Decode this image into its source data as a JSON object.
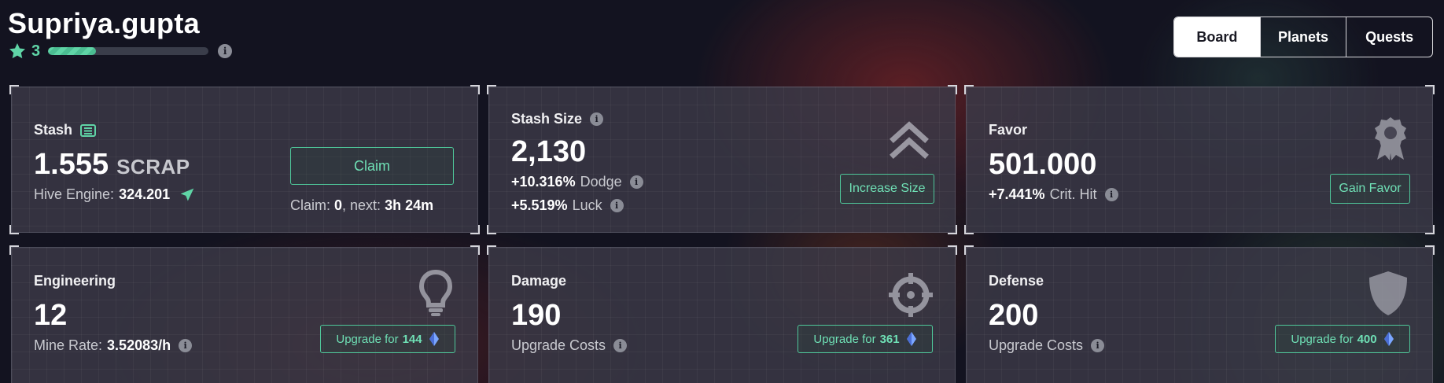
{
  "user": {
    "name": "Supriya.gupta",
    "level": "3",
    "xp_fraction": 0.3
  },
  "tabs": [
    {
      "label": "Board",
      "active": true
    },
    {
      "label": "Planets",
      "active": false
    },
    {
      "label": "Quests",
      "active": false
    }
  ],
  "stash": {
    "title": "Stash",
    "value": "1.555",
    "unit": "SCRAP",
    "hive_label": "Hive Engine:",
    "hive_value": "324.201",
    "claim_button": "Claim",
    "claim_label": "Claim:",
    "claim_count": "0",
    "next_label": ", next:",
    "next_time": "3h 24m"
  },
  "stash_size": {
    "title": "Stash Size",
    "value": "2,130",
    "dodge_value": "+10.316%",
    "dodge_label": "Dodge",
    "luck_value": "+5.519%",
    "luck_label": "Luck",
    "button": "Increase Size"
  },
  "favor": {
    "title": "Favor",
    "value": "501.000",
    "crit_value": "+7.441%",
    "crit_label": "Crit. Hit",
    "button": "Gain Favor"
  },
  "engineering": {
    "title": "Engineering",
    "value": "12",
    "rate_label": "Mine Rate:",
    "rate_value": "3.52083/h",
    "button_prefix": "Upgrade for",
    "button_cost": "144"
  },
  "damage": {
    "title": "Damage",
    "value": "190",
    "sub_label": "Upgrade Costs",
    "button_prefix": "Upgrade for",
    "button_cost": "361"
  },
  "defense": {
    "title": "Defense",
    "value": "200",
    "sub_label": "Upgrade Costs",
    "button_prefix": "Upgrade for",
    "button_cost": "400"
  },
  "colors": {
    "accent": "#5fd4a6",
    "button_border": "#4fc79a"
  },
  "icons": {
    "stash_title": "list-icon",
    "hive": "paper-plane-icon",
    "stash_size": "double-chevron-up-icon",
    "favor": "award-badge-icon",
    "engineering": "lightbulb-icon",
    "damage": "crosshair-icon",
    "defense": "shield-icon",
    "currency": "crystal-icon"
  }
}
